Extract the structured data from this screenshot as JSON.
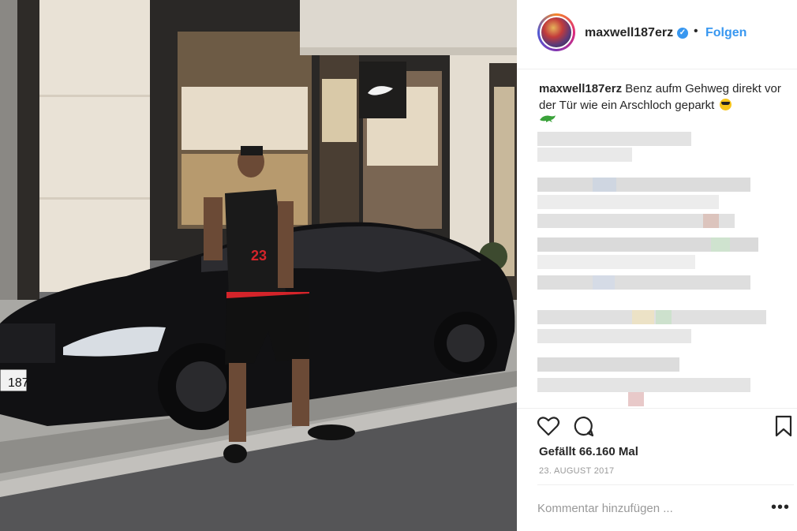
{
  "post": {
    "username": "maxwell187erz",
    "verified_mark": "✓",
    "separator": "•",
    "follow_label": "Folgen",
    "caption_text": "Benz aufm Gehweg direkt vor der Tür wie ein Arschloch geparkt",
    "caption_emoji": "smiling-face-with-sunglasses-icon",
    "caption_emoji_2": "crocodile-icon",
    "likes_text": "Gefällt 66.160 Mal",
    "date_text": "23. AUGUST 2017",
    "comment_placeholder": "Kommentar hinzufügen ...",
    "more_options": "•••"
  },
  "photo": {
    "license_plate_text": "187",
    "jersey_number": "23",
    "description_icons": [
      "lacoste-sign-icon",
      "car-icon",
      "person-icon"
    ]
  },
  "colors": {
    "accent": "#3897f0",
    "text": "#262626",
    "muted": "#999999",
    "divider": "#efefef"
  },
  "icons": {
    "like": "heart-icon",
    "comment": "speech-bubble-icon",
    "save": "bookmark-icon"
  }
}
